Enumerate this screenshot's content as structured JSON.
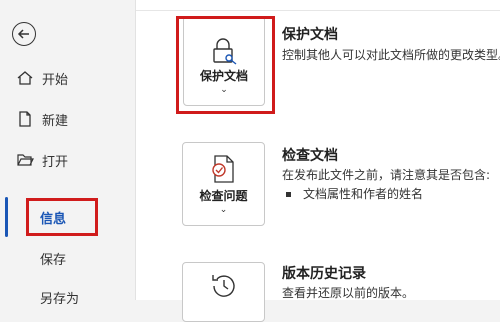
{
  "nav": {
    "items": [
      {
        "label": "开始",
        "icon": "home-icon"
      },
      {
        "label": "新建",
        "icon": "new-document-icon"
      },
      {
        "label": "打开",
        "icon": "open-folder-icon"
      },
      {
        "label": "信息",
        "icon": ""
      },
      {
        "label": "保存",
        "icon": ""
      },
      {
        "label": "另存为",
        "icon": ""
      }
    ],
    "active": "信息"
  },
  "sections": [
    {
      "tile_label": "保护文档",
      "title": "保护文档",
      "description": "控制其他人可以对此文档所做的更改类型。"
    },
    {
      "tile_label": "检查问题",
      "title": "检查文档",
      "description": "在发布此文件之前，请注意其是否包含:",
      "bullets": [
        "文档属性和作者的姓名"
      ]
    },
    {
      "tile_label": "",
      "title": "版本历史记录",
      "description": "查看并还原以前的版本。"
    }
  ],
  "colors": {
    "accent": "#1a56b5",
    "highlight": "#d01b1b",
    "nav_bg": "#f3f3f3",
    "panel_bg": "#ffffff"
  }
}
